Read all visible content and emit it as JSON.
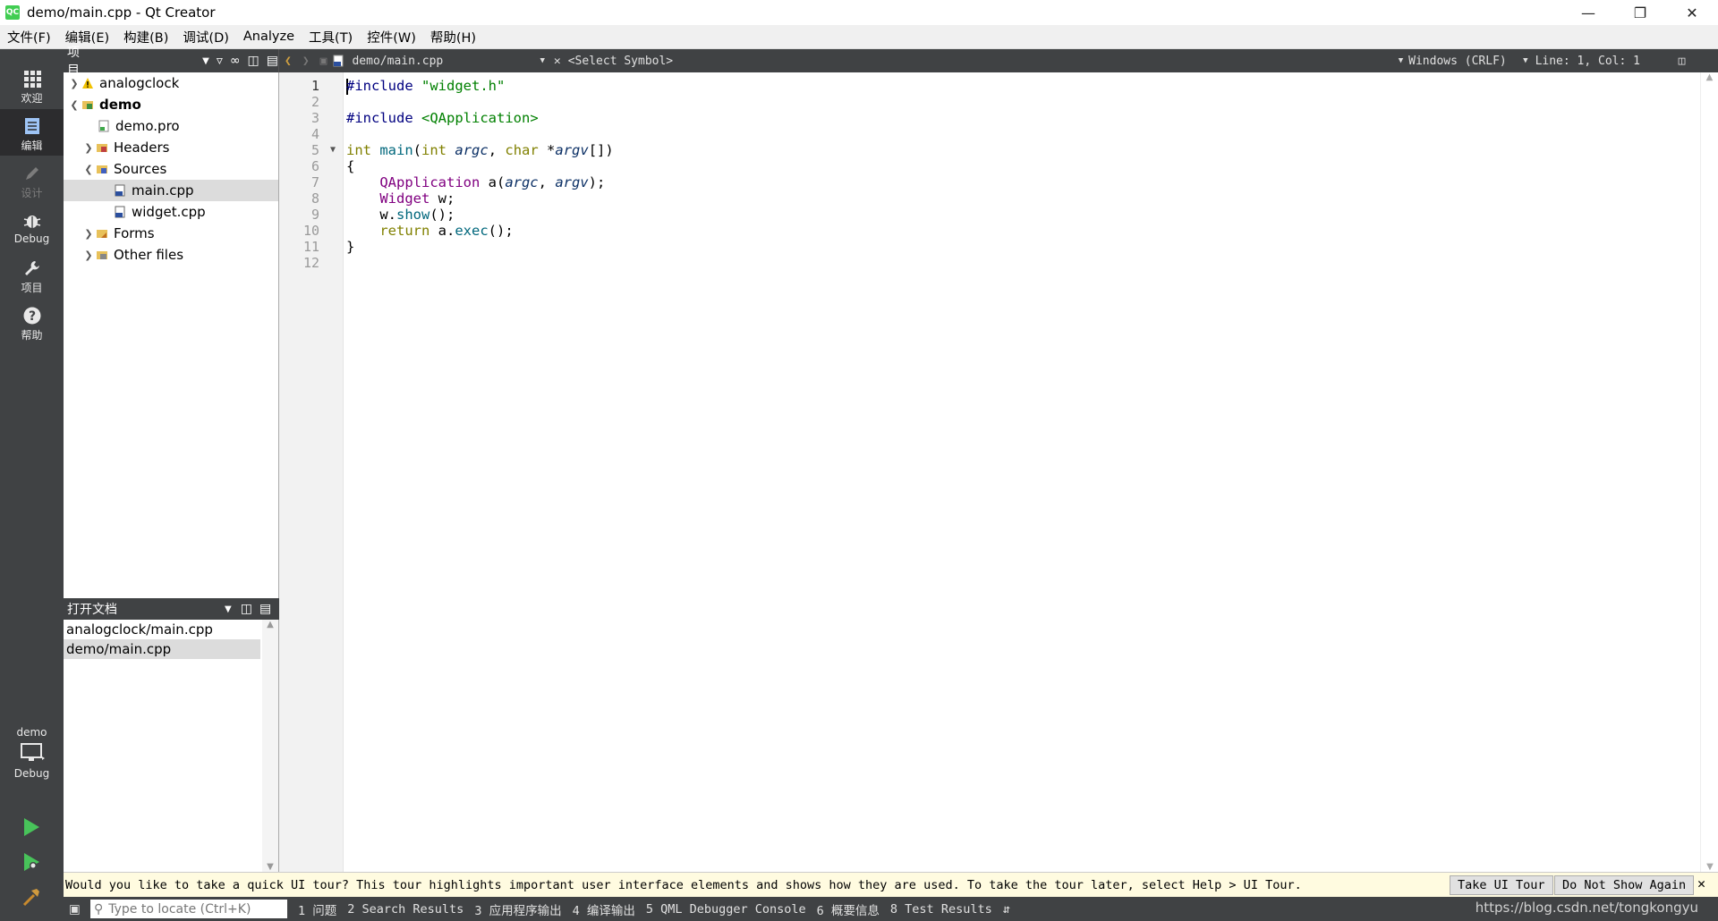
{
  "window": {
    "title": "demo/main.cpp - Qt Creator",
    "app_icon": "QC"
  },
  "menu": [
    "文件(F)",
    "编辑(E)",
    "构建(B)",
    "调试(D)",
    "Analyze",
    "工具(T)",
    "控件(W)",
    "帮助(H)"
  ],
  "modes": [
    {
      "label": "欢迎",
      "icon": "grid-icon"
    },
    {
      "label": "编辑",
      "icon": "document-icon"
    },
    {
      "label": "设计",
      "icon": "pencil-icon"
    },
    {
      "label": "Debug",
      "icon": "bug-icon"
    },
    {
      "label": "项目",
      "icon": "wrench-icon"
    },
    {
      "label": "帮助",
      "icon": "help-icon"
    }
  ],
  "kit": {
    "project": "demo",
    "build": "Debug"
  },
  "sidebar": {
    "title": "项目"
  },
  "tree": [
    {
      "label": "analogclock",
      "level": 0,
      "expanded": false,
      "icon": "warning-icon"
    },
    {
      "label": "demo",
      "level": 0,
      "expanded": true,
      "bold": true,
      "icon": "project-folder-icon"
    },
    {
      "label": "demo.pro",
      "level": 1,
      "icon": "pro-file-icon"
    },
    {
      "label": "Headers",
      "level": 1,
      "expanded": false,
      "icon": "folder-icon"
    },
    {
      "label": "Sources",
      "level": 1,
      "expanded": true,
      "icon": "folder-icon"
    },
    {
      "label": "main.cpp",
      "level": 2,
      "selected": true,
      "icon": "cpp-file-icon"
    },
    {
      "label": "widget.cpp",
      "level": 2,
      "icon": "cpp-file-icon"
    },
    {
      "label": "Forms",
      "level": 1,
      "expanded": false,
      "icon": "folder-icon"
    },
    {
      "label": "Other files",
      "level": 1,
      "expanded": false,
      "icon": "folder-icon"
    }
  ],
  "open_docs": {
    "title": "打开文档",
    "items": [
      "analogclock/main.cpp",
      "demo/main.cpp"
    ],
    "selected": 1
  },
  "editor": {
    "file": "demo/main.cpp",
    "symbol": "<Select Symbol>",
    "line_ending": "Windows (CRLF)",
    "position": "Line: 1, Col: 1",
    "current_line": 1,
    "lines": [
      "#include \"widget.h\"",
      "",
      "#include <QApplication>",
      "",
      "int main(int argc, char *argv[])",
      "{",
      "    QApplication a(argc, argv);",
      "    Widget w;",
      "    w.show();",
      "    return a.exec();",
      "}",
      ""
    ]
  },
  "infobar": {
    "message": "Would you like to take a quick UI tour? This tour highlights important user interface elements and shows how they are used. To take the tour later, select Help > UI Tour.",
    "take_tour": "Take UI Tour",
    "dont_show": "Do Not Show Again"
  },
  "status": {
    "locate_placeholder": "Type to locate (Ctrl+K)",
    "panes": [
      "1 问题",
      "2 Search Results",
      "3 应用程序输出",
      "4 编译输出",
      "5 QML Debugger Console",
      "6 概要信息",
      "8 Test Results"
    ]
  },
  "watermark": "https://blog.csdn.net/tongkongyu",
  "colors": {
    "dark": "#404244",
    "selected": "#dcdcdc",
    "keyword": "#808000",
    "string": "#008000",
    "type": "#800080"
  }
}
